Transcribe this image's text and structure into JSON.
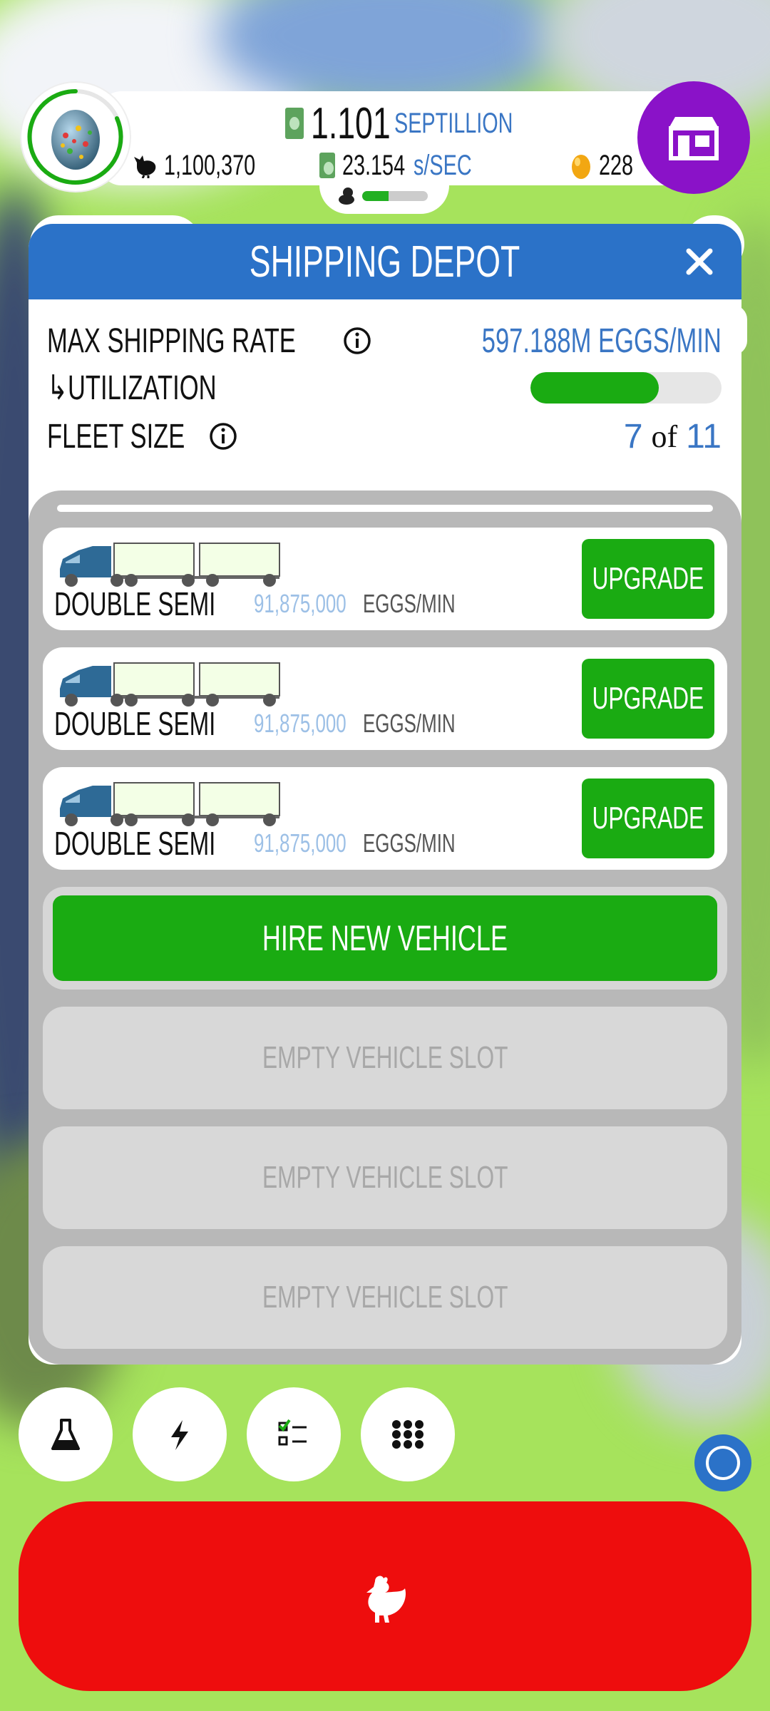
{
  "hud": {
    "money_value": "1.101",
    "money_unit": "SEPTILLION",
    "rate_value": "23.154",
    "rate_unit": "s/SEC",
    "chickens": "1,100,370",
    "golden_eggs": "228",
    "drone_progress": 0.4
  },
  "modal": {
    "title": "SHIPPING DEPOT",
    "max_rate_label": "MAX SHIPPING RATE",
    "max_rate_value": "597.188M EGGS/MIN",
    "utilization_label": "↳UTILIZATION",
    "utilization": 0.67,
    "fleet_label": "FLEET SIZE",
    "fleet_current": "7",
    "fleet_of": "of",
    "fleet_max": "11"
  },
  "vehicles": [
    {
      "name": "DOUBLE SEMI",
      "rate": "91,875,000",
      "unit": "EGGS/MIN",
      "button": "UPGRADE"
    },
    {
      "name": "DOUBLE SEMI",
      "rate": "91,875,000",
      "unit": "EGGS/MIN",
      "button": "UPGRADE"
    },
    {
      "name": "DOUBLE SEMI",
      "rate": "91,875,000",
      "unit": "EGGS/MIN",
      "button": "UPGRADE"
    }
  ],
  "hire_label": "HIRE NEW VEHICLE",
  "empty_slots": [
    "EMPTY VEHICLE SLOT",
    "EMPTY VEHICLE SLOT",
    "EMPTY VEHICLE SLOT"
  ],
  "colors": {
    "header_blue": "#2b72c8",
    "green": "#1aab12",
    "hatch_red": "#ee0d0d",
    "shop_purple": "#8a12c8"
  },
  "icons": {
    "bottom": [
      "flask-icon",
      "lightning-icon",
      "checklist-icon",
      "grid-icon"
    ]
  }
}
